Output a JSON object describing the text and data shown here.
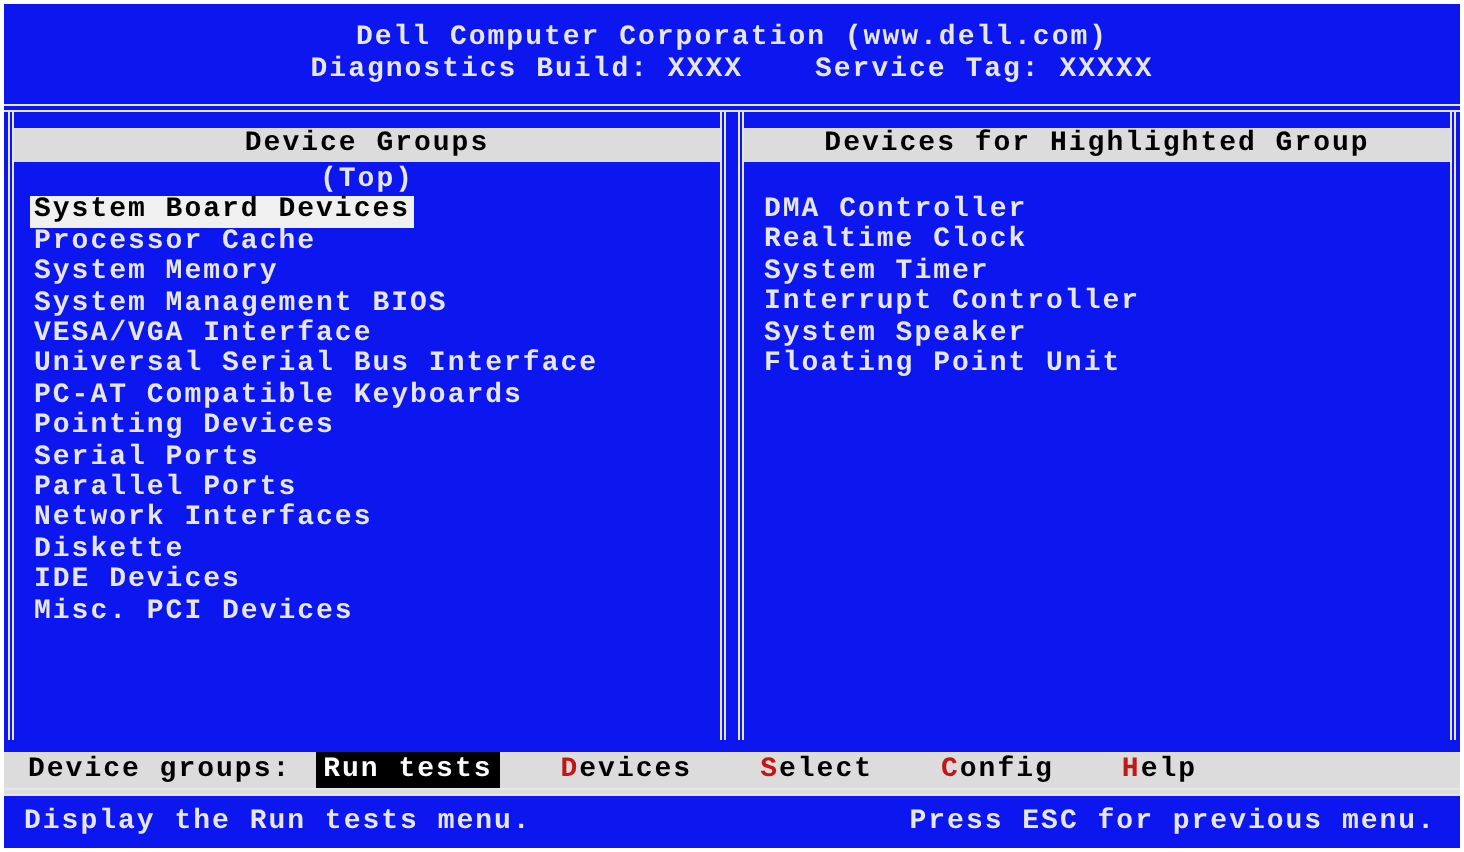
{
  "header": {
    "title": "Dell Computer Corporation (www.dell.com)",
    "build": "Diagnostics Build: XXXX",
    "service_tag": "Service Tag: XXXXX"
  },
  "left_panel": {
    "title": "Device Groups",
    "scroll_label": "(Top)",
    "items": [
      {
        "label": "System Board Devices",
        "selected": true
      },
      {
        "label": "Processor Cache",
        "selected": false
      },
      {
        "label": "System Memory",
        "selected": false
      },
      {
        "label": "System Management BIOS",
        "selected": false
      },
      {
        "label": "VESA/VGA Interface",
        "selected": false
      },
      {
        "label": "Universal Serial Bus Interface",
        "selected": false
      },
      {
        "label": "PC-AT Compatible Keyboards",
        "selected": false
      },
      {
        "label": "Pointing Devices",
        "selected": false
      },
      {
        "label": "Serial Ports",
        "selected": false
      },
      {
        "label": "Parallel Ports",
        "selected": false
      },
      {
        "label": "Network Interfaces",
        "selected": false
      },
      {
        "label": "Diskette",
        "selected": false
      },
      {
        "label": "IDE Devices",
        "selected": false
      },
      {
        "label": "Misc. PCI Devices",
        "selected": false
      }
    ]
  },
  "right_panel": {
    "title": "Devices for Highlighted Group",
    "items": [
      "DMA Controller",
      "Realtime Clock",
      "System Timer",
      "Interrupt Controller",
      "System Speaker",
      "Floating Point Unit"
    ]
  },
  "menu_bar": {
    "label": "Device groups:",
    "items": [
      {
        "label": "Run tests",
        "selected": true
      },
      {
        "label": "Devices",
        "selected": false
      },
      {
        "label": "Select",
        "selected": false
      },
      {
        "label": "Config",
        "selected": false
      },
      {
        "label": "Help",
        "selected": false
      }
    ]
  },
  "status_bar": {
    "left": "Display the Run tests menu.",
    "right": "Press ESC for previous menu."
  }
}
